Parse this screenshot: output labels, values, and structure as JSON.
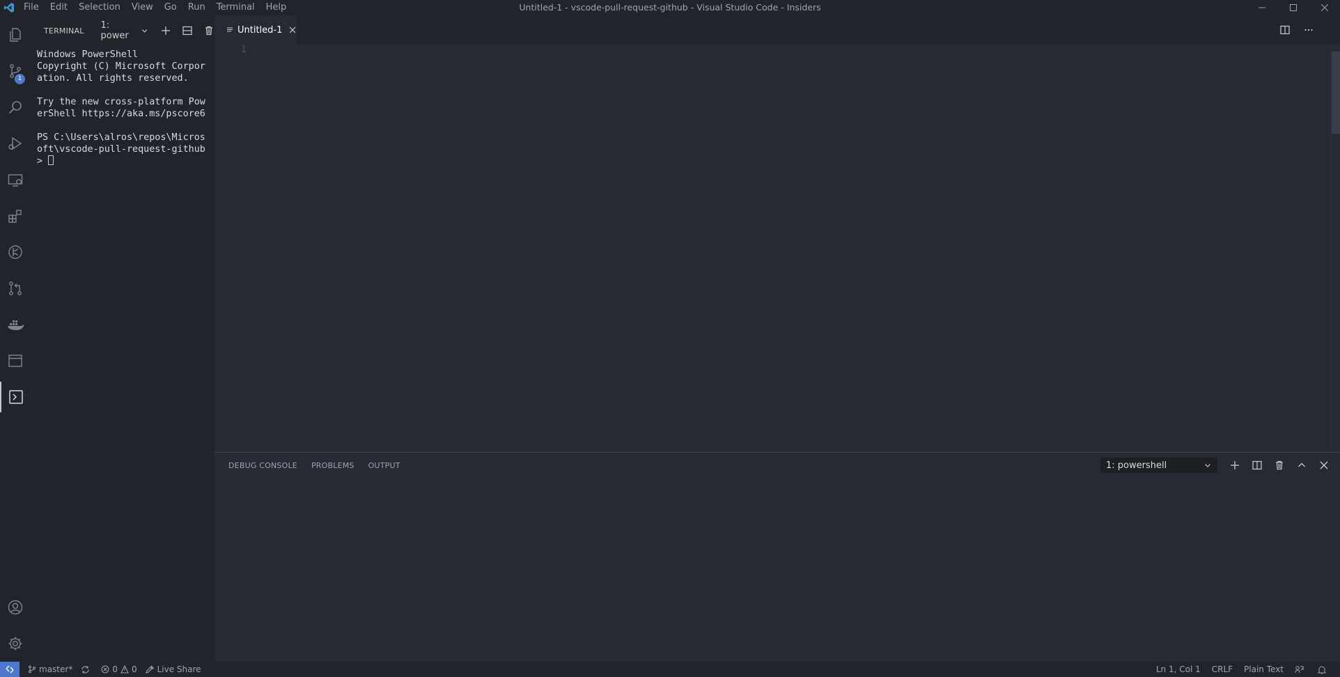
{
  "titlebar": {
    "menu": [
      "File",
      "Edit",
      "Selection",
      "View",
      "Go",
      "Run",
      "Terminal",
      "Help"
    ],
    "window_title": "Untitled-1 - vscode-pull-request-github - Visual Studio Code - Insiders",
    "controls": [
      "minimize-icon",
      "maximize-icon",
      "close-icon"
    ]
  },
  "activitybar": {
    "items": [
      "explorer-icon",
      "source-control-icon",
      "search-icon",
      "run-debug-icon",
      "remote-explorer-icon",
      "extensions-icon",
      "timeline-icon",
      "pull-requests-icon",
      "docker-icon",
      "browser-icon",
      "terminal-icon"
    ],
    "source_control_badge": "1",
    "bottom": [
      "accounts-icon",
      "settings-icon"
    ]
  },
  "sidebar": {
    "title": "TERMINAL",
    "terminal_select": "1: power",
    "terminal_lines": [
      "Windows PowerShell",
      "Copyright (C) Microsoft Corpor",
      "ation. All rights reserved.",
      "",
      "Try the new cross-platform Pow",
      "erShell https://aka.ms/pscore6",
      "",
      "PS C:\\Users\\alros\\repos\\Micros",
      "oft\\vscode-pull-request-github",
      "> "
    ]
  },
  "editor": {
    "tab_label": "Untitled-1",
    "line_number": "1"
  },
  "panel": {
    "tabs": [
      "DEBUG CONSOLE",
      "PROBLEMS",
      "OUTPUT"
    ],
    "terminal_select": "1: powershell"
  },
  "statusbar": {
    "branch": "master*",
    "errors": "0",
    "warnings": "0",
    "live_share": "Live Share",
    "cursor_position": "Ln 1, Col 1",
    "eol": "CRLF",
    "language": "Plain Text"
  },
  "colors": {
    "background": "#262a33",
    "chrome": "#21252b",
    "accent": "#4d78cc",
    "vscode_logo": "#3c99d4"
  }
}
